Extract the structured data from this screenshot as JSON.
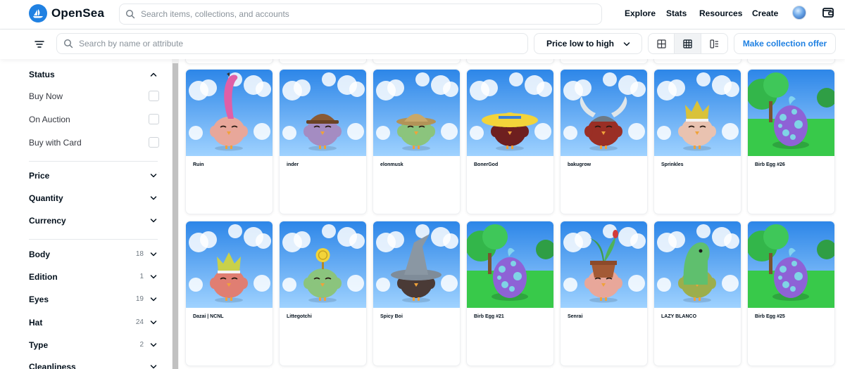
{
  "header": {
    "brand": "OpenSea",
    "search_placeholder": "Search items, collections, and accounts",
    "nav": [
      "Explore",
      "Stats",
      "Resources",
      "Create"
    ]
  },
  "toolbar": {
    "trait_search_placeholder": "Search by name or attribute",
    "sort_label": "Price low to high",
    "offer_label": "Make collection offer",
    "views": [
      "large-grid-icon",
      "small-grid-icon",
      "list-view-icon"
    ],
    "active_view": 1
  },
  "sidebar": {
    "status_title": "Status",
    "status_options": [
      "Buy Now",
      "On Auction",
      "Buy with Card"
    ],
    "filters": [
      "Price",
      "Quantity",
      "Currency"
    ],
    "traits": [
      {
        "name": "Body",
        "count": "18"
      },
      {
        "name": "Edition",
        "count": "1"
      },
      {
        "name": "Eyes",
        "count": "19"
      },
      {
        "name": "Hat",
        "count": "24"
      },
      {
        "name": "Type",
        "count": "2"
      },
      {
        "name": "Cleanliness",
        "count": ""
      }
    ]
  },
  "items": [
    {
      "name": "Ruin",
      "scene": "sky",
      "body": "#e8a79a",
      "accessory": "flamingo",
      "accent": "#e05fa7"
    },
    {
      "name": "inder",
      "scene": "sky",
      "body": "#a48cc2",
      "accessory": "cap",
      "accent": "#8a5a34"
    },
    {
      "name": "elonmusk",
      "scene": "sky",
      "body": "#8bc47d",
      "accessory": "safari-hat",
      "accent": "#c8a86a"
    },
    {
      "name": "BonerGod",
      "scene": "sky",
      "body": "#6e1f1f",
      "accessory": "sun-hat",
      "accent": "#f2d43a"
    },
    {
      "name": "bakugrow",
      "scene": "sky",
      "body": "#9a2f25",
      "accessory": "horns",
      "accent": "#6d7a86"
    },
    {
      "name": "Sprinkles",
      "scene": "sky",
      "body": "#e9c2b0",
      "accessory": "crown",
      "accent": "#d9c23a"
    },
    {
      "name": "Birb Egg #26",
      "scene": "egg",
      "body": "#8e62d6",
      "accessory": "egg",
      "accent": "#7fd4e6"
    },
    {
      "name": "Dazai | NCNL",
      "scene": "sky",
      "body": "#e07e72",
      "accessory": "crown",
      "accent": "#c9d14a"
    },
    {
      "name": "Littegotchi",
      "scene": "sky",
      "body": "#8bc47d",
      "accessory": "coin",
      "accent": "#f2d43a"
    },
    {
      "name": "Spicy Boi",
      "scene": "sky",
      "body": "#4a3a36",
      "accessory": "wizard-hat",
      "accent": "#7f8c99"
    },
    {
      "name": "Birb Egg #21",
      "scene": "egg",
      "body": "#8e62d6",
      "accessory": "egg",
      "accent": "#7fd4e6"
    },
    {
      "name": "Senrai",
      "scene": "sky",
      "body": "#e8a79a",
      "accessory": "pot-plant",
      "accent": "#a35a35"
    },
    {
      "name": "LAZY BLANCO",
      "scene": "sky",
      "body": "#9cae4c",
      "accessory": "dino",
      "accent": "#5fbf6e"
    },
    {
      "name": "Birb Egg #25",
      "scene": "egg",
      "body": "#8e62d6",
      "accessory": "egg",
      "accent": "#7fd4e6"
    }
  ],
  "colors": {
    "accent": "#2081e2",
    "text": "#04111d",
    "border": "#e5e8eb",
    "sky_top": "#2d86e8",
    "sky_bottom": "#9fd2ff",
    "grass": "#38c94a"
  }
}
